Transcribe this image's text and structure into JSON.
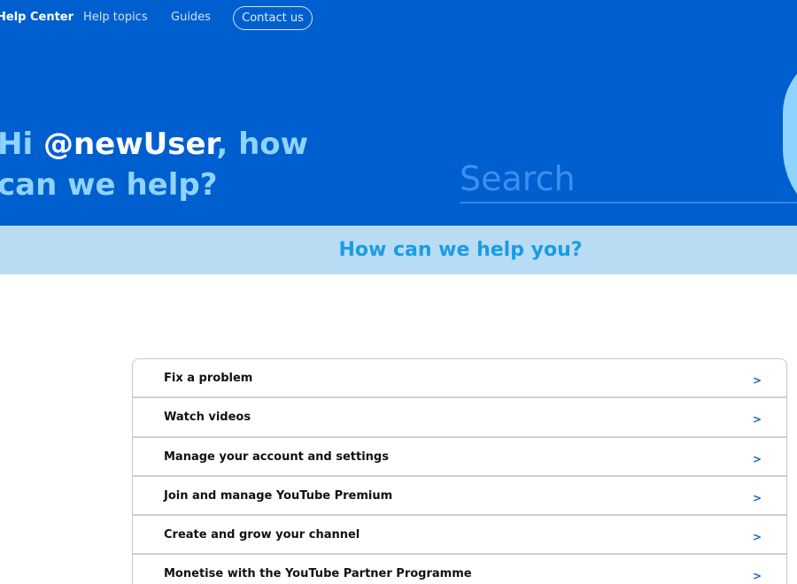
{
  "nav": {
    "brand": "Help Center",
    "links": [
      "Help topics",
      "Guides"
    ],
    "contact_label": "Contact us"
  },
  "hero": {
    "greeting_prefix": "Hi ",
    "username": "@newUser",
    "greeting_suffix": ", how can we help?",
    "search_placeholder": "Search"
  },
  "help_bar": {
    "title": "How can we help you?"
  },
  "topics": [
    {
      "label": "Fix a problem",
      "arrow": ">"
    },
    {
      "label": "Watch videos",
      "arrow": ">"
    },
    {
      "label": "Manage your account and settings",
      "arrow": ">"
    },
    {
      "label": "Join and manage YouTube Premium",
      "arrow": ">"
    },
    {
      "label": "Create and grow your channel",
      "arrow": ">"
    },
    {
      "label": "Monetise with the YouTube Partner Programme",
      "arrow": ">"
    }
  ],
  "colors": {
    "hero_bg": "#005fce",
    "accent_light": "#8fd3ff",
    "help_bar_bg": "#b9dcf5",
    "help_bar_text": "#1a9be6",
    "arrow": "#1565c0"
  }
}
